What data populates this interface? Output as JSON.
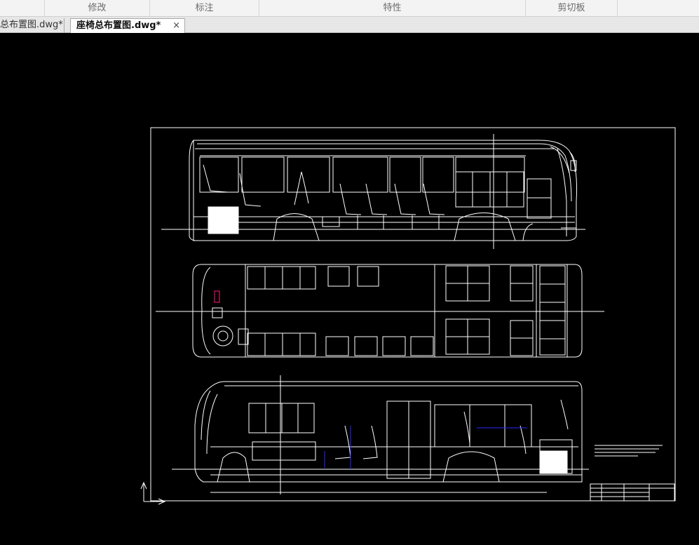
{
  "ribbon": {
    "panels": [
      "",
      "修改",
      "标注",
      "特性",
      "剪切板",
      ""
    ]
  },
  "tabs": {
    "inactive_label": "总布置图.dwg*",
    "active_label": "座椅总布置图.dwg*",
    "close_glyph": "×"
  },
  "drawing": {
    "colors": {
      "background": "#000000",
      "line": "#ffffff",
      "accent_blue": "#2a2aff",
      "accent_magenta": "#ff1a7a"
    },
    "ucs_icon": "ucs-axis-icon"
  }
}
